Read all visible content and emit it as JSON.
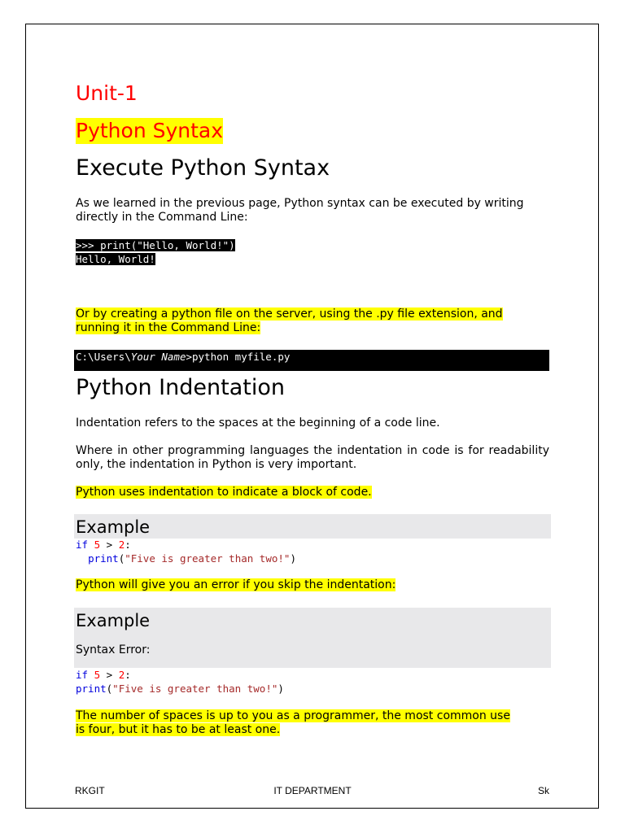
{
  "unit": "Unit-1",
  "section_title": "Python Syntax",
  "heading1": "Execute Python Syntax",
  "para1": "As we learned in the previous page, Python syntax can be executed by writing directly in the Command Line:",
  "code1": [
    ">>> print(\"Hello, World!\")",
    "Hello, World!"
  ],
  "para2_line1": "Or by creating a python file on the server, using the .py file extension, and",
  "para2_line2": "running it in the Command Line:",
  "cmd": {
    "prefix": "C:\\Users\\",
    "italic": "Your Name",
    "suffix": ">python myfile.py"
  },
  "heading2": "Python Indentation",
  "para3": "Indentation refers to the spaces at the beginning of a code line.",
  "para4": "Where in other programming languages the indentation in code is for readability only, the indentation in Python is very important.",
  "para5": "Python uses indentation to indicate a block of code.",
  "example1": {
    "title": "Example",
    "code": {
      "kw_if": "if",
      "n5": "5",
      "gt": " > ",
      "n2": "2",
      "colon": ":",
      "indent": "  ",
      "print": "print",
      "open": "(",
      "str": "\"Five is greater than two!\"",
      "close": ")"
    }
  },
  "para6": "Python will give you an error if you skip the indentation:",
  "example2": {
    "title": "Example",
    "subtitle": "Syntax Error:"
  },
  "para7_line1": "The number of spaces is up to you as a programmer, the most common use",
  "para7_line2": "is four, but it has to be at least one.",
  "footer": {
    "left": "RKGIT",
    "center": "IT DEPARTMENT",
    "right": "Sk"
  }
}
